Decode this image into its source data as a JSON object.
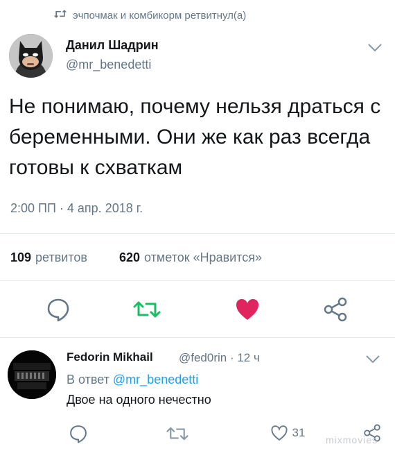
{
  "retweet_context": {
    "text": "эчпочмак и комбикорм ретвитнул(а)",
    "icon": "retweet-icon"
  },
  "tweet": {
    "author_name": "Данил Шадрин",
    "author_handle": "@mr_benedetti",
    "text": "Не понимаю, почему нельзя драться с беременными. Они же как раз всегда готовы к схваткам",
    "timestamp": "2:00 ПП · 4 апр. 2018 г.",
    "stats": {
      "retweets_count": "109",
      "retweets_label": "ретвитов",
      "likes_count": "620",
      "likes_label": "отметок «Нравится»"
    },
    "actions": [
      "reply-icon",
      "retweet-icon",
      "heart-icon",
      "share-icon"
    ]
  },
  "reply": {
    "author_name": "Fedorin Mikhail",
    "handle_time": "@fed0rin · 12 ч",
    "reply_to_prefix": "В ответ",
    "reply_to_handle": "@mr_benedetti",
    "text": "Двое на одного нечестно",
    "likes_count": "31"
  },
  "watermark": "mixmovies",
  "colors": {
    "text": "#14171a",
    "secondary": "#657786",
    "link": "#1da1f2",
    "retweet_green": "#17bf63",
    "like_red": "#e0245e",
    "divider": "#e6ecf0"
  }
}
